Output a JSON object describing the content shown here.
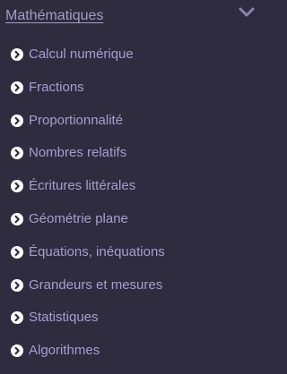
{
  "header": {
    "title": "Mathématiques",
    "toggle_icon": "chevron-down-icon"
  },
  "menu": {
    "bullet_icon": "chevron-right-circle-icon",
    "items": [
      {
        "label": "Calcul numérique"
      },
      {
        "label": "Fractions"
      },
      {
        "label": "Proportionnalité"
      },
      {
        "label": "Nombres relatifs"
      },
      {
        "label": "Écritures littérales"
      },
      {
        "label": "Géométrie plane"
      },
      {
        "label": "Équations, inéquations"
      },
      {
        "label": "Grandeurs et mesures"
      },
      {
        "label": "Statistiques"
      },
      {
        "label": "Algorithmes"
      }
    ]
  },
  "colors": {
    "background": "#2e2c3e",
    "text": "#a79ed1",
    "bullet": "#ffffff",
    "chevron": "#8b84b0"
  }
}
